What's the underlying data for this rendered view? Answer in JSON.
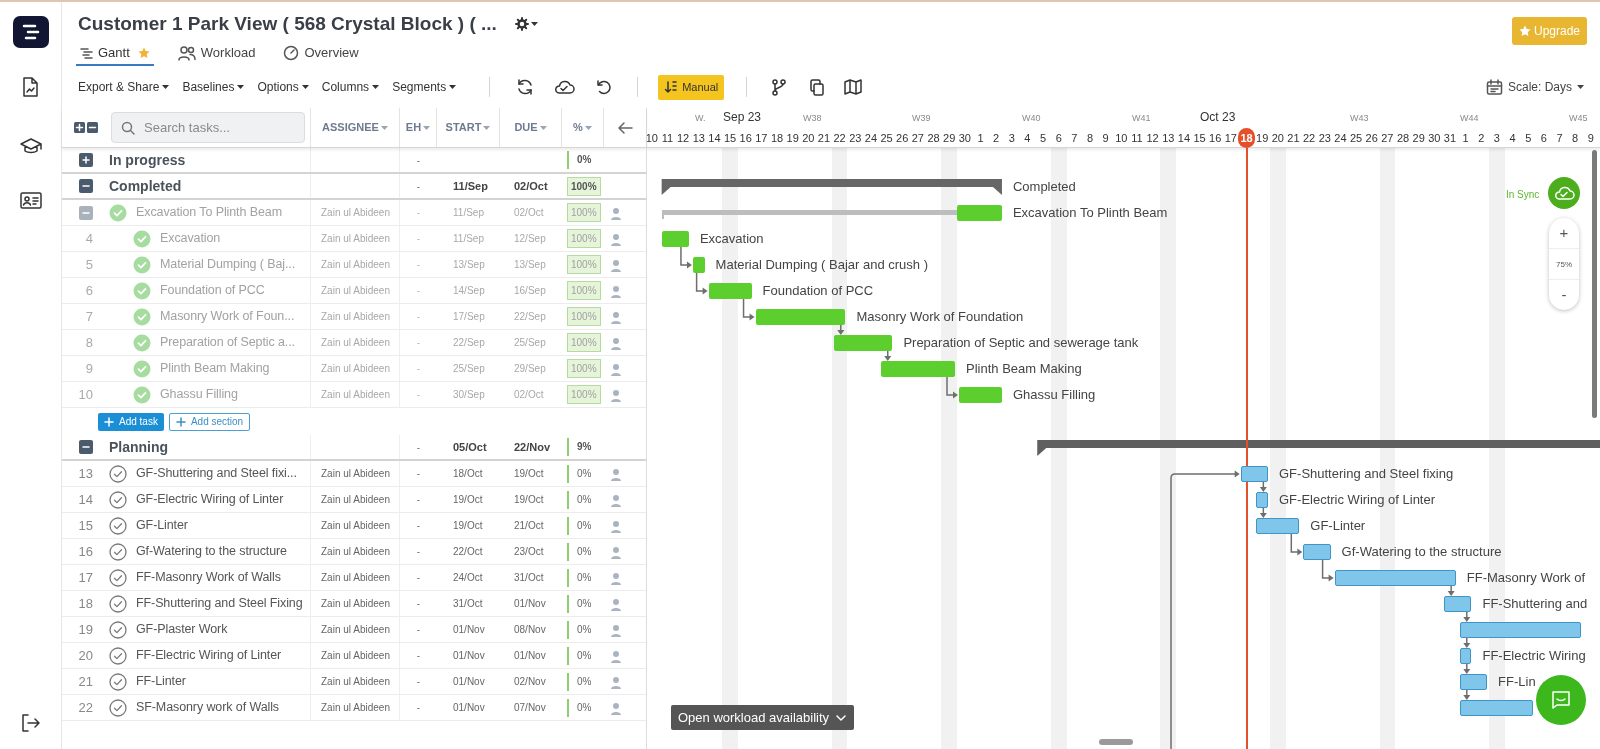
{
  "app": {
    "title": "Customer 1 Park View ( 568 Crystal Block ) ( ...",
    "upgrade_label": "Upgrade"
  },
  "tabs": [
    {
      "label": "Gantt",
      "kind": "gantt",
      "selected": true,
      "starred": true
    },
    {
      "label": "Workload",
      "kind": "workload",
      "selected": false,
      "starred": false
    },
    {
      "label": "Overview",
      "kind": "overview",
      "selected": false,
      "starred": false
    }
  ],
  "toolbar": {
    "menus": [
      "Export & Share",
      "Baselines",
      "Options",
      "Columns",
      "Segments"
    ],
    "mode_button": "Manual",
    "scale": "Scale: Days"
  },
  "table": {
    "search_placeholder": "Search tasks...",
    "columns": [
      "ASSIGNEE",
      "EH",
      "START",
      "DUE",
      "%"
    ]
  },
  "timeline": {
    "labels": [
      {
        "label": "W.",
        "kind": "week"
      },
      {
        "label": "Sep 23",
        "kind": "month"
      },
      {
        "label": "W38",
        "kind": "week"
      },
      {
        "label": "W39",
        "kind": "week"
      },
      {
        "label": "W40",
        "kind": "week"
      },
      {
        "label": "W41",
        "kind": "week"
      },
      {
        "label": "Oct 23",
        "kind": "month"
      },
      {
        "label": "W43",
        "kind": "week"
      },
      {
        "label": "W44",
        "kind": "week"
      },
      {
        "label": "W45",
        "kind": "week"
      }
    ],
    "days": [
      {
        "label": "10",
        "today": false
      },
      {
        "label": "11",
        "today": false
      },
      {
        "label": "12",
        "today": false
      },
      {
        "label": "13",
        "today": false
      },
      {
        "label": "14",
        "today": false
      },
      {
        "label": "15",
        "today": false
      },
      {
        "label": "16",
        "today": false
      },
      {
        "label": "17",
        "today": false
      },
      {
        "label": "18",
        "today": false
      },
      {
        "label": "19",
        "today": false
      },
      {
        "label": "20",
        "today": false
      },
      {
        "label": "21",
        "today": false
      },
      {
        "label": "22",
        "today": false
      },
      {
        "label": "23",
        "today": false
      },
      {
        "label": "24",
        "today": false
      },
      {
        "label": "25",
        "today": false
      },
      {
        "label": "26",
        "today": false
      },
      {
        "label": "27",
        "today": false
      },
      {
        "label": "28",
        "today": false
      },
      {
        "label": "29",
        "today": false
      },
      {
        "label": "30",
        "today": false
      },
      {
        "label": "1",
        "today": false
      },
      {
        "label": "2",
        "today": false
      },
      {
        "label": "3",
        "today": false
      },
      {
        "label": "4",
        "today": false
      },
      {
        "label": "5",
        "today": false
      },
      {
        "label": "6",
        "today": false
      },
      {
        "label": "7",
        "today": false
      },
      {
        "label": "8",
        "today": false
      },
      {
        "label": "9",
        "today": false
      },
      {
        "label": "10",
        "today": false
      },
      {
        "label": "11",
        "today": false
      },
      {
        "label": "12",
        "today": false
      },
      {
        "label": "13",
        "today": false
      },
      {
        "label": "14",
        "today": false
      },
      {
        "label": "15",
        "today": false
      },
      {
        "label": "16",
        "today": false
      },
      {
        "label": "17",
        "today": false
      },
      {
        "label": "18",
        "today": true
      },
      {
        "label": "19",
        "today": false
      },
      {
        "label": "20",
        "today": false
      },
      {
        "label": "21",
        "today": false
      },
      {
        "label": "22",
        "today": false
      },
      {
        "label": "23",
        "today": false
      },
      {
        "label": "24",
        "today": false
      },
      {
        "label": "25",
        "today": false
      },
      {
        "label": "26",
        "today": false
      },
      {
        "label": "27",
        "today": false
      },
      {
        "label": "28",
        "today": false
      },
      {
        "label": "29",
        "today": false
      },
      {
        "label": "30",
        "today": false
      },
      {
        "label": "31",
        "today": false
      },
      {
        "label": "1",
        "today": false
      },
      {
        "label": "2",
        "today": false
      },
      {
        "label": "3",
        "today": false
      },
      {
        "label": "4",
        "today": false
      },
      {
        "label": "5",
        "today": false
      },
      {
        "label": "6",
        "today": false
      },
      {
        "label": "7",
        "today": false
      },
      {
        "label": "8",
        "today": false
      },
      {
        "label": "9",
        "today": false
      }
    ]
  },
  "sections": [
    {
      "name": "In progress",
      "expanded": false,
      "done": false,
      "eh": "-",
      "percent": "0%"
    },
    {
      "name": "Completed",
      "expanded": true,
      "done": true,
      "eh": "-",
      "start": "11/Sep",
      "due": "02/Oct",
      "percent": "100%",
      "bar_label": "Completed",
      "tasks": [
        {
          "name": "Excavation To Plinth Beam",
          "done": true,
          "expanded": true,
          "assignee": "Zain ul Abideen",
          "eh": "-",
          "start": "11/Sep",
          "due": "02/Oct",
          "percent": "100%",
          "bar_label": "Excavation To Plinth Beam",
          "children": [
            {
              "number": "4",
              "name": "Excavation",
              "done": true,
              "assignee": "Zain ul Abideen",
              "eh": "-",
              "start": "11/Sep",
              "due": "12/Sep",
              "percent": "100%",
              "bar_label": "Excavation"
            },
            {
              "number": "5",
              "name": "Material Dumping ( Baj...",
              "done": true,
              "assignee": "Zain ul Abideen",
              "eh": "-",
              "start": "13/Sep",
              "due": "13/Sep",
              "percent": "100%",
              "bar_label": "Material Dumping ( Bajar and crush )"
            },
            {
              "number": "6",
              "name": "Foundation of PCC",
              "done": true,
              "assignee": "Zain ul Abideen",
              "eh": "-",
              "start": "14/Sep",
              "due": "16/Sep",
              "percent": "100%",
              "bar_label": "Foundation of PCC"
            },
            {
              "number": "7",
              "name": "Masonry Work of Foun...",
              "done": true,
              "assignee": "Zain ul Abideen",
              "eh": "-",
              "start": "17/Sep",
              "due": "22/Sep",
              "percent": "100%",
              "bar_label": "Masonry Work of Foundation"
            },
            {
              "number": "8",
              "name": "Preparation of Septic a...",
              "done": true,
              "assignee": "Zain ul Abideen",
              "eh": "-",
              "start": "22/Sep",
              "due": "25/Sep",
              "percent": "100%",
              "bar_label": "Preparation of Septic and sewerage tank"
            },
            {
              "number": "9",
              "name": "Plinth Beam Making",
              "done": true,
              "assignee": "Zain ul Abideen",
              "eh": "-",
              "start": "25/Sep",
              "due": "29/Sep",
              "percent": "100%",
              "bar_label": "Plinth Beam Making"
            },
            {
              "number": "10",
              "name": "Ghassu Filling",
              "done": true,
              "assignee": "Zain ul Abideen",
              "eh": "-",
              "start": "30/Sep",
              "due": "02/Oct",
              "percent": "100%",
              "bar_label": "Ghassu Filling"
            }
          ]
        }
      ],
      "add_buttons": [
        "Add task",
        "Add section"
      ]
    },
    {
      "name": "Planning",
      "expanded": true,
      "done": false,
      "eh": "-",
      "start": "05/Oct",
      "due": "22/Nov",
      "percent": "9%",
      "tasks": [
        {
          "number": "13",
          "name": "GF-Shuttering and Steel fixi...",
          "done": false,
          "assignee": "Zain ul Abideen",
          "eh": "-",
          "start": "18/Oct",
          "due": "19/Oct",
          "percent": "0%",
          "bar_label": "GF-Shuttering and Steel fixing"
        },
        {
          "number": "14",
          "name": "GF-Electric Wiring of Linter",
          "done": false,
          "assignee": "Zain ul Abideen",
          "eh": "-",
          "start": "19/Oct",
          "due": "19/Oct",
          "percent": "0%",
          "bar_label": "GF-Electric Wiring of Linter"
        },
        {
          "number": "15",
          "name": "GF-Linter",
          "done": false,
          "assignee": "Zain ul Abideen",
          "eh": "-",
          "start": "19/Oct",
          "due": "21/Oct",
          "percent": "0%",
          "bar_label": "GF-Linter"
        },
        {
          "number": "16",
          "name": "Gf-Watering to the structure",
          "done": false,
          "assignee": "Zain ul Abideen",
          "eh": "-",
          "start": "22/Oct",
          "due": "23/Oct",
          "percent": "0%",
          "bar_label": "Gf-Watering to the structure"
        },
        {
          "number": "17",
          "name": "FF-Masonry Work of Walls",
          "done": false,
          "assignee": "Zain ul Abideen",
          "eh": "-",
          "start": "24/Oct",
          "due": "31/Oct",
          "percent": "0%",
          "bar_label": "FF-Masonry Work of"
        },
        {
          "number": "18",
          "name": "FF-Shuttering and Steel Fixing",
          "done": false,
          "assignee": "Zain ul Abideen",
          "eh": "-",
          "start": "31/Oct",
          "due": "01/Nov",
          "percent": "0%",
          "bar_label": "FF-Shuttering and"
        },
        {
          "number": "19",
          "name": "GF-Plaster Work",
          "done": false,
          "assignee": "Zain ul Abideen",
          "eh": "-",
          "start": "01/Nov",
          "due": "08/Nov",
          "percent": "0%"
        },
        {
          "number": "20",
          "name": "FF-Electric Wiring of Linter",
          "done": false,
          "assignee": "Zain ul Abideen",
          "eh": "-",
          "start": "01/Nov",
          "due": "01/Nov",
          "percent": "0%",
          "bar_label": "FF-Electric Wiring"
        },
        {
          "number": "21",
          "name": "FF-Linter",
          "done": false,
          "assignee": "Zain ul Abideen",
          "eh": "-",
          "start": "01/Nov",
          "due": "02/Nov",
          "percent": "0%",
          "bar_label": "FF-Lin"
        },
        {
          "number": "22",
          "name": "SF-Masonry work of Walls",
          "done": false,
          "assignee": "Zain ul Abideen",
          "eh": "-",
          "start": "01/Nov",
          "due": "07/Nov",
          "percent": "0%"
        }
      ]
    }
  ],
  "sync": {
    "label": "In Sync"
  },
  "zoom_control": {
    "zoom_in": "+",
    "level_label": "75%",
    "zoom_out": "-"
  },
  "workload_button": "Open workload availability"
}
